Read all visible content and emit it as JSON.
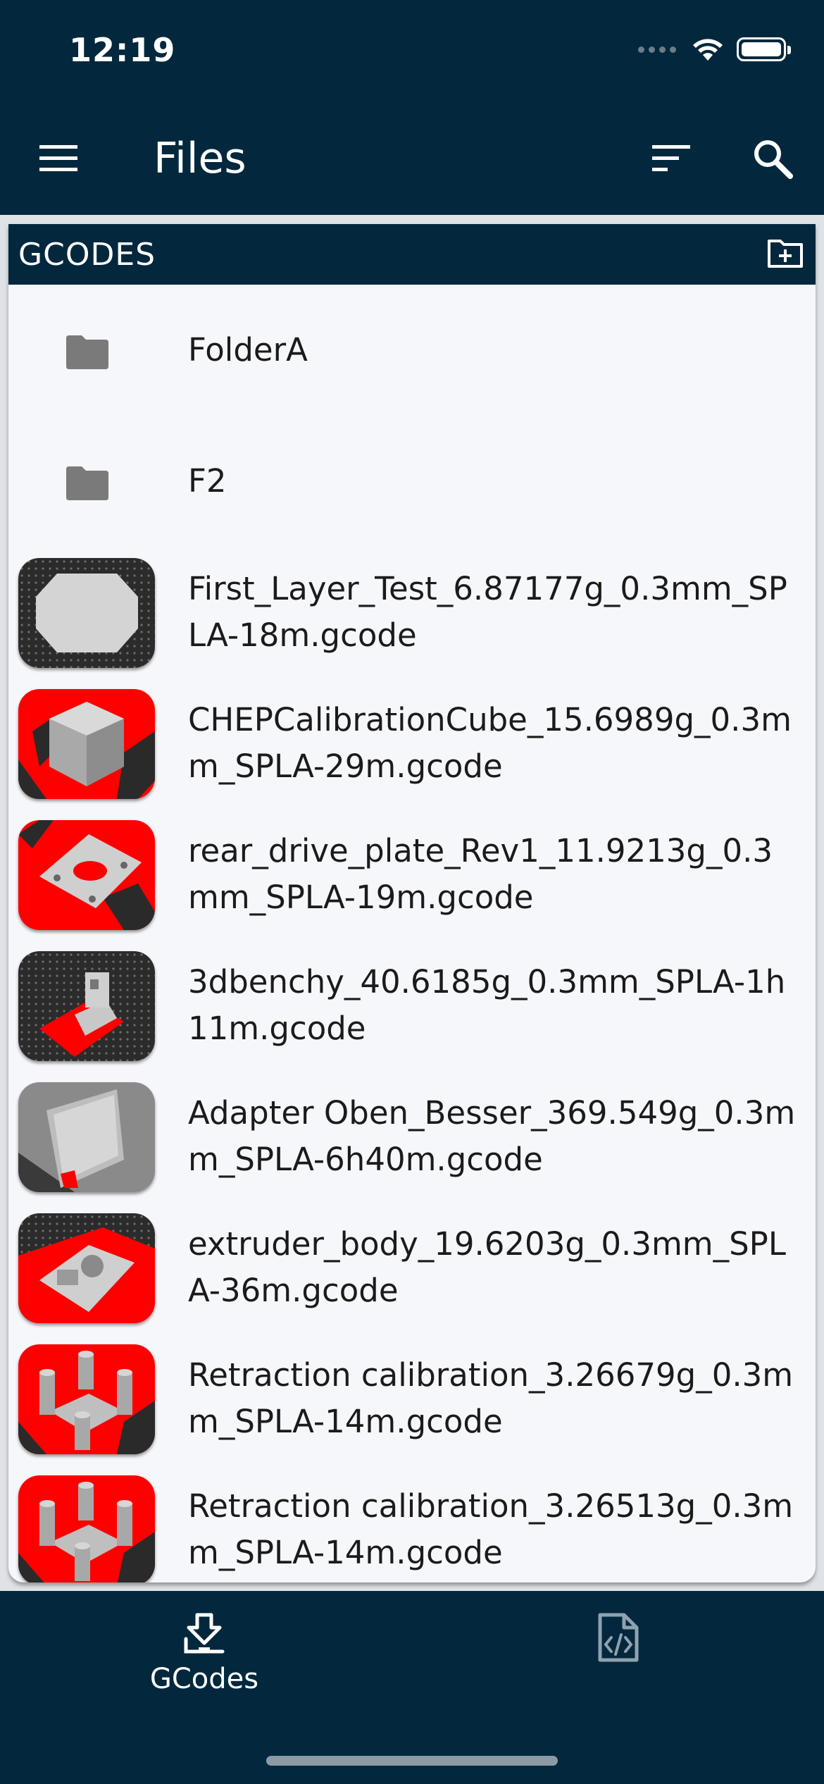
{
  "status_bar": {
    "time": "12:19"
  },
  "app_bar": {
    "title": "Files"
  },
  "section": {
    "title": "GCODES"
  },
  "folders": [
    {
      "name": "FolderA"
    },
    {
      "name": "F2"
    }
  ],
  "files": [
    {
      "name": "First_Layer_Test_6.87177g_0.3mm_SPLA-18m.gcode",
      "thumbnail": "first-layer-thumbnail"
    },
    {
      "name": "CHEPCalibrationCube_15.6989g_0.3mm_SPLA-29m.gcode",
      "thumbnail": "calibration-cube-thumbnail"
    },
    {
      "name": "rear_drive_plate_Rev1_11.9213g_0.3mm_SPLA-19m.gcode",
      "thumbnail": "drive-plate-thumbnail"
    },
    {
      "name": "3dbenchy_40.6185g_0.3mm_SPLA-1h11m.gcode",
      "thumbnail": "benchy-thumbnail"
    },
    {
      "name": "Adapter Oben_Besser_369.549g_0.3mm_SPLA-6h40m.gcode",
      "thumbnail": "adapter-thumbnail"
    },
    {
      "name": "extruder_body_19.6203g_0.3mm_SPLA-36m.gcode",
      "thumbnail": "extruder-thumbnail"
    },
    {
      "name": "Retraction calibration_3.26679g_0.3mm_SPLA-14m.gcode",
      "thumbnail": "retraction-thumbnail"
    },
    {
      "name": "Retraction calibration_3.26513g_0.3mm_SPLA-14m.gcode",
      "thumbnail": "retraction-thumbnail"
    }
  ],
  "tabs": [
    {
      "label": "GCodes",
      "icon": "printer-download-icon",
      "active": true
    },
    {
      "label": "",
      "icon": "file-code-icon",
      "active": false
    }
  ],
  "colors": {
    "primary": "#03283d",
    "background": "#f6f7fb",
    "folder_icon": "#7a7a7a",
    "thumb_red": "#ff0000"
  }
}
